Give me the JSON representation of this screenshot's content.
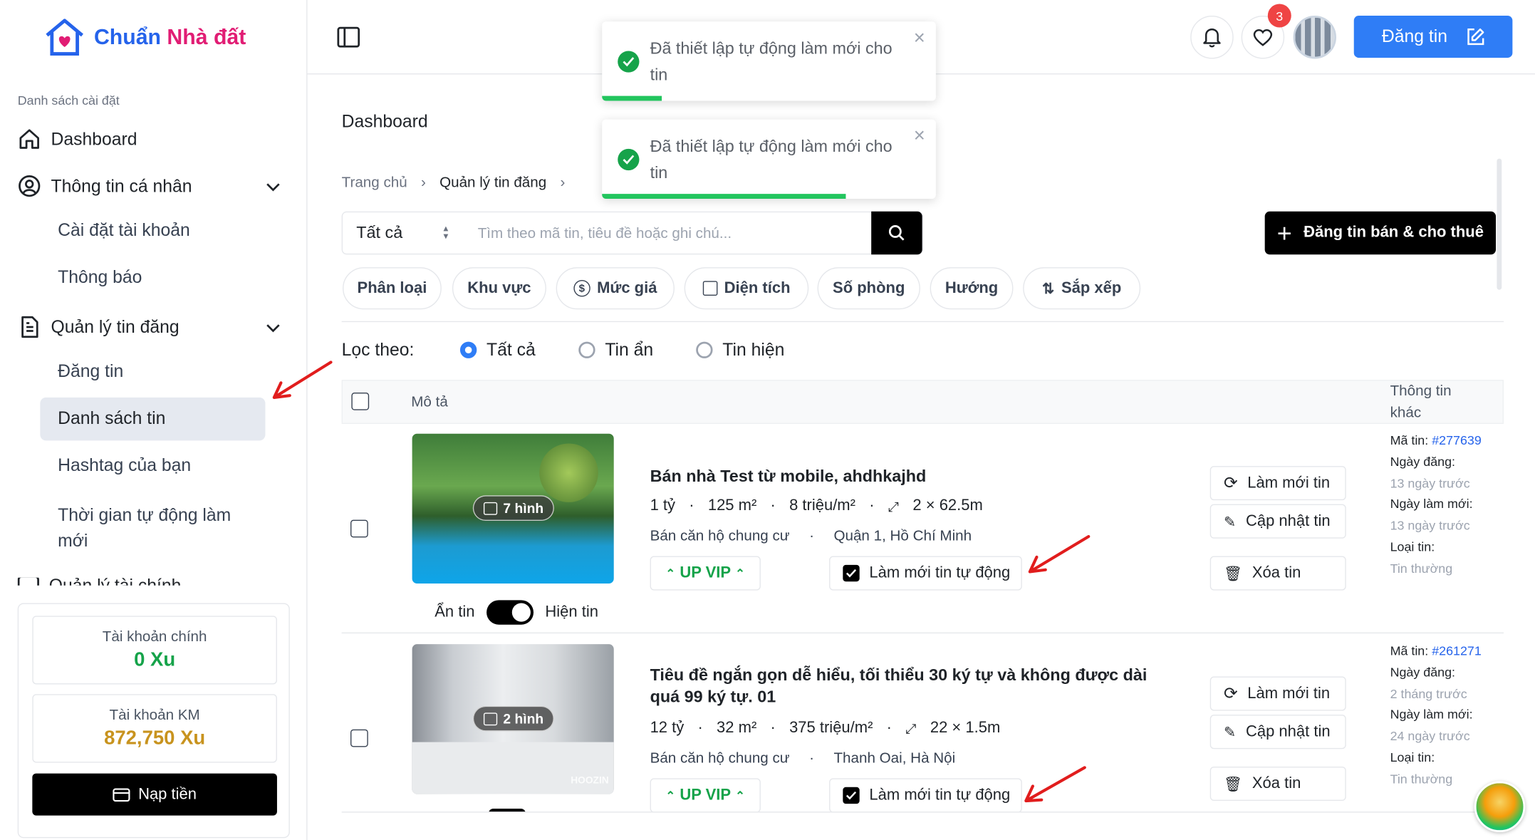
{
  "brand": {
    "part1": "Chuẩn",
    "part2": "Nhà đất",
    "accent": "#2563eb",
    "accent2": "#e11d74"
  },
  "sidebar": {
    "caption": "Danh sách cài đặt",
    "items": [
      {
        "label": "Dashboard",
        "icon": "home-icon"
      },
      {
        "label": "Thông tin cá nhân",
        "icon": "user-circle-icon"
      },
      {
        "label": "Cài đặt tài khoản"
      },
      {
        "label": "Thông báo"
      },
      {
        "label": "Quản lý tin đăng",
        "icon": "document-icon"
      },
      {
        "label": "Đăng tin"
      },
      {
        "label": "Danh sách tin"
      },
      {
        "label": "Hashtag của bạn"
      },
      {
        "label": "Thời gian tự động làm mới"
      },
      {
        "label": "Quản lý tài chính"
      }
    ],
    "account": {
      "main_label": "Tài khoản chính",
      "main_value": "0 Xu",
      "promo_label": "Tài khoản KM",
      "promo_value": "872,750 Xu",
      "topup_label": "Nạp tiền"
    }
  },
  "header": {
    "notifications_count": "3",
    "post_label": "Đăng tin"
  },
  "toasts": [
    {
      "text": "Đã thiết lập tự động làm mới cho tin",
      "progress": 0.18
    },
    {
      "text": "Đã thiết lập tự động làm mới cho tin",
      "progress": 0.73
    }
  ],
  "page": {
    "title": "Dashboard",
    "breadcrumb": [
      "Trang chủ",
      "Quản lý tin đăng"
    ],
    "search": {
      "select_value": "Tất cả",
      "placeholder": "Tìm theo mã tin, tiêu đề hoặc ghi chú..."
    },
    "create_button": "Đăng tin bán & cho thuê",
    "chips": [
      "Phân loại",
      "Khu vực",
      "Mức giá",
      "Diện tích",
      "Số phòng",
      "Hướng",
      "Sắp xếp"
    ],
    "filter": {
      "label": "Lọc theo:",
      "options": [
        "Tất cả",
        "Tin ẩn",
        "Tin hiện"
      ],
      "selected": "Tất cả"
    },
    "table": {
      "col_desc": "Mô tả",
      "col_info": "Thông tin khác"
    }
  },
  "listings": [
    {
      "title": "Bán nhà Test từ mobile, ahdhkajhd",
      "price": "1 tỷ",
      "area": "125 m²",
      "unit_price": "8 triệu/m²",
      "size": "2 × 62.5m",
      "type": "Bán căn hộ chung cư",
      "location": "Quận 1, Hồ Chí Minh",
      "images": "7 hình",
      "vip": "UP VIP",
      "auto": "Làm mới tin tự động",
      "actions": [
        "Làm mới tin",
        "Cập nhật tin",
        "Xóa tin"
      ],
      "toggle_off": "Ẩn tin",
      "toggle_on": "Hiện tin",
      "info": {
        "id_label": "Mã tin:",
        "id": "#277639",
        "posted_label": "Ngày đăng:",
        "posted": "13 ngày trước",
        "refresh_label": "Ngày làm mới:",
        "refresh": "13 ngày trước",
        "type_label": "Loại tin:",
        "type": "Tin thường"
      }
    },
    {
      "title": "Tiêu đề ngắn gọn dễ hiểu, tối thiểu 30 ký tự và không được dài quá 99 ký tự. 01",
      "price": "12 tỷ",
      "area": "32 m²",
      "unit_price": "375 triệu/m²",
      "size": "22 × 1.5m",
      "type": "Bán căn hộ chung cư",
      "location": "Thanh Oai, Hà Nội",
      "images": "2 hình",
      "vip": "UP VIP",
      "auto": "Làm mới tin tự động",
      "actions": [
        "Làm mới tin",
        "Cập nhật tin",
        "Xóa tin"
      ],
      "watermark": "HOOZIN",
      "info": {
        "id_label": "Mã tin:",
        "id": "#261271",
        "posted_label": "Ngày đăng:",
        "posted": "2 tháng trước",
        "refresh_label": "Ngày làm mới:",
        "refresh": "24 ngày trước",
        "type_label": "Loại tin:",
        "type": "Tin thường"
      }
    }
  ]
}
